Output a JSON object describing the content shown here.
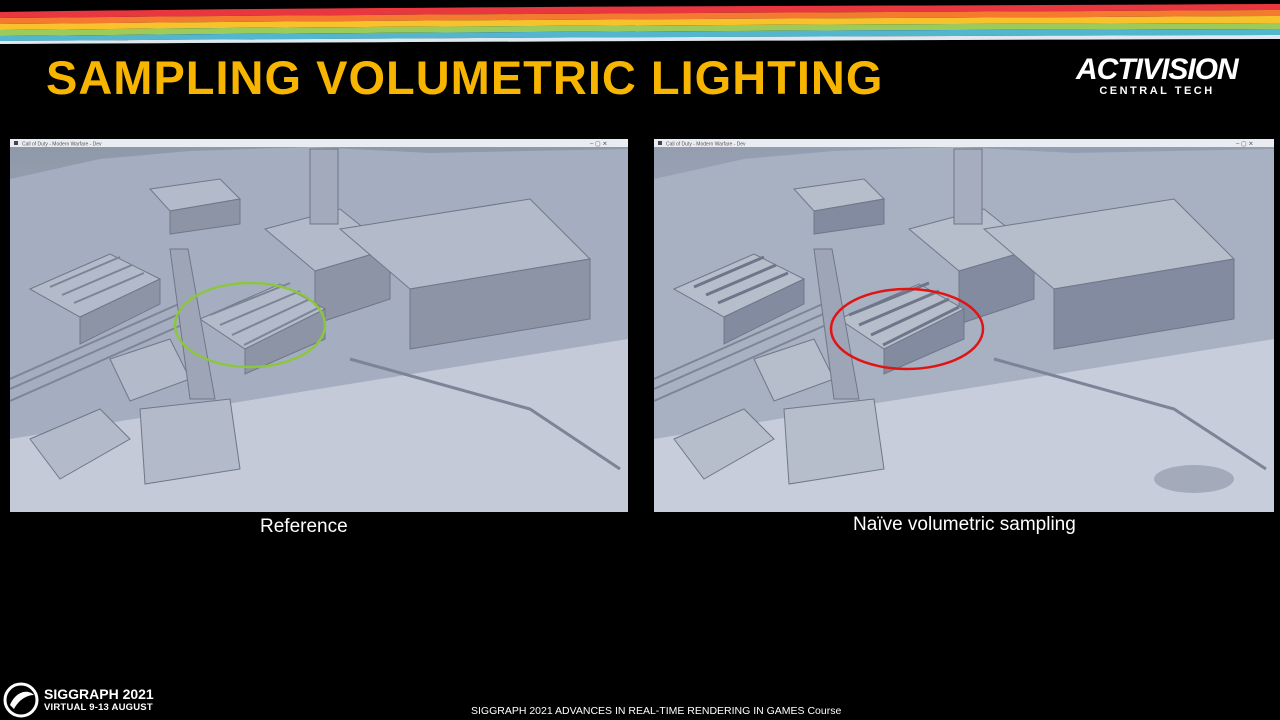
{
  "slide": {
    "title": "SAMPLING VOLUMETRIC LIGHTING",
    "footer": "SIGGRAPH 2021 ADVANCES IN REAL-TIME RENDERING IN GAMES Course"
  },
  "logo": {
    "main": "ACTIVISION",
    "sub": "CENTRAL TECH"
  },
  "images": [
    {
      "caption": "Reference",
      "highlight_color": "#8cc63f",
      "highlight_icon": "ellipse-highlight"
    },
    {
      "caption": "Naïve volumetric sampling",
      "highlight_color": "#e01414",
      "highlight_icon": "ellipse-highlight"
    }
  ],
  "siggraph": {
    "name": "SIGGRAPH 2021",
    "dates": "VIRTUAL  9-13 AUGUST",
    "icon": "siggraph-logo-icon"
  },
  "colors": {
    "title": "#f7b500",
    "background": "#000000",
    "stripes": [
      "#e8373f",
      "#f47a30",
      "#f8c22c",
      "#9dcb5b",
      "#52b6cf",
      "#ffffff"
    ]
  }
}
